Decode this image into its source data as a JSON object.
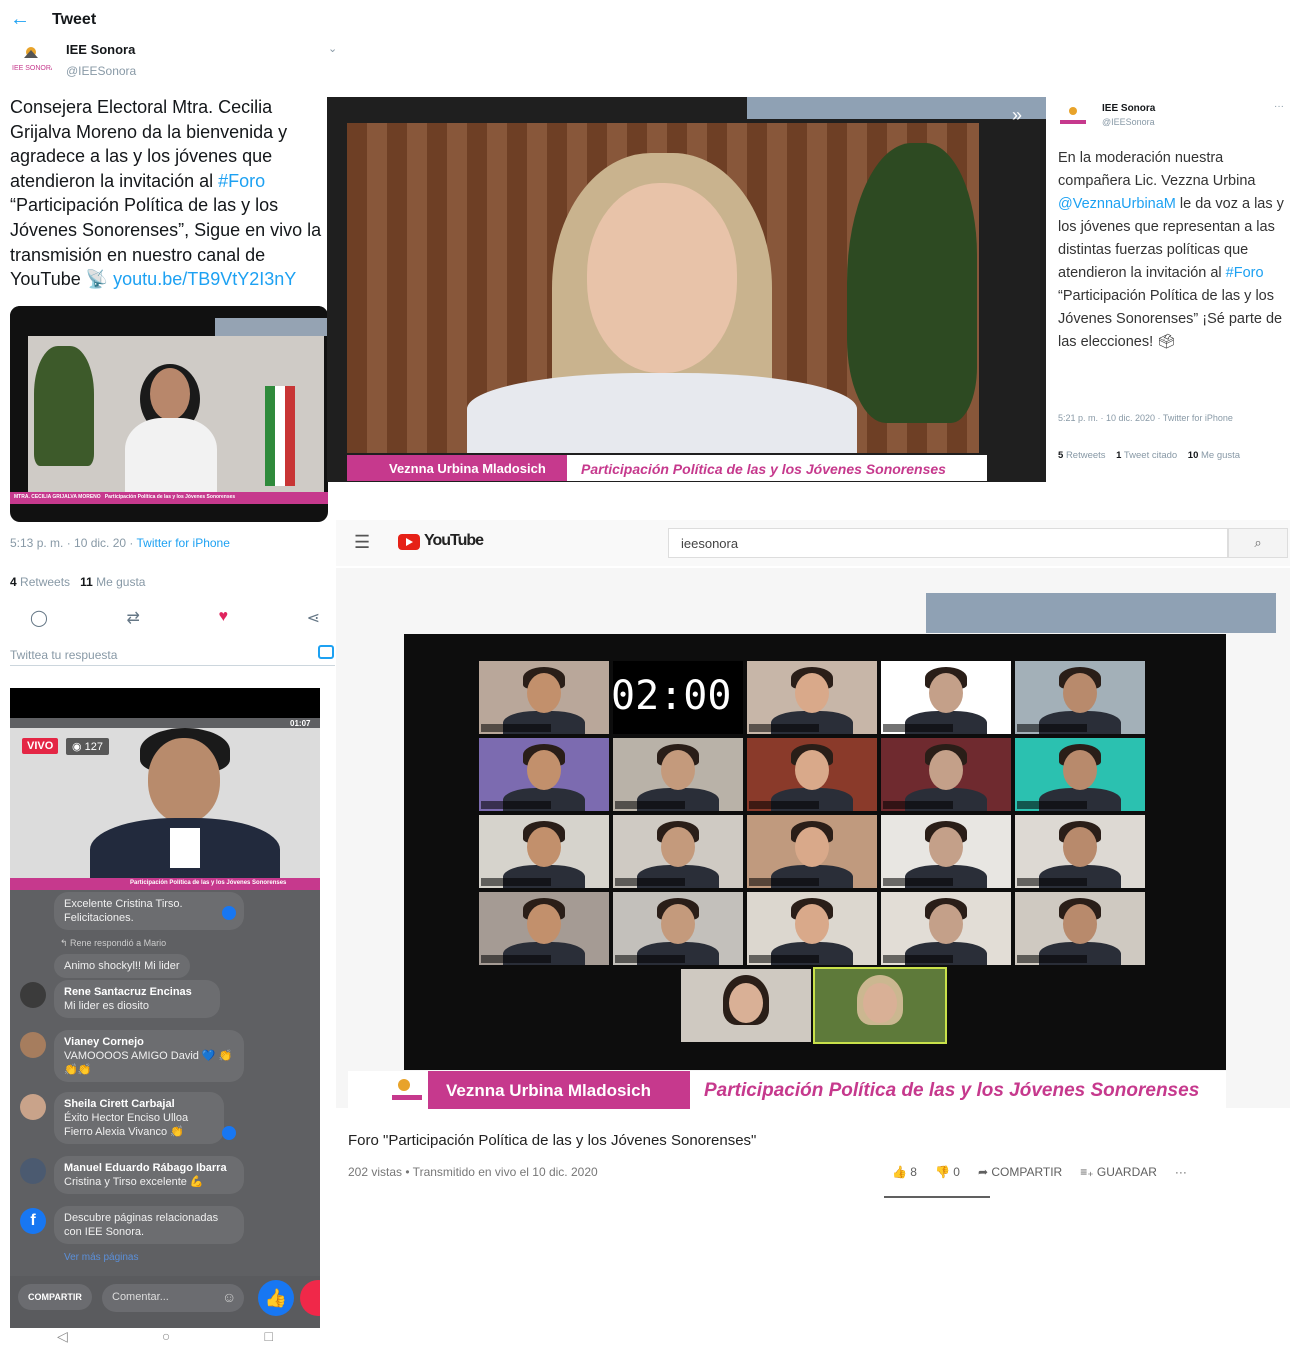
{
  "tweet1": {
    "header_title": "Tweet",
    "account_name": "IEE Sonora",
    "account_handle": "@IEESonora",
    "text": "Consejera Electoral Mtra. Cecilia Grijalva Moreno da la bienvenida y agradece a las y los jóvenes que atendieron la invitación al ",
    "hashtag": "#Foro",
    "text2": " “Participación Política de las y los Jóvenes Sonorenses”, Sigue en vivo la transmisión en nuestro canal de YouTube 📡 ",
    "link": "youtu.be/TB9VtY2I3nY",
    "video_name_tag": "MTRA. CECILIA GRIJALVA MORENO",
    "video_banner": "Participación Política de las y los Jóvenes Sonorenses",
    "time": "5:13 p. m. · 10 dic. 20 · ",
    "source": "Twitter for iPhone",
    "retweets_count": "4",
    "retweets_label": "Retweets",
    "likes_count": "11",
    "likes_label": "Me gusta",
    "reply_placeholder": "Twittea tu respuesta"
  },
  "tweet2": {
    "account_name": "IEE Sonora",
    "account_handle": "@IEESonora",
    "text_a": "En la moderación nuestra compañera Lic. Vezzna Urbina ",
    "mention": "@VeznnaUrbinaM",
    "text_b": " le da voz a las y los jóvenes que representan a las distintas fuerzas políticas que atendieron la invitación al ",
    "hashtag": "#Foro",
    "text_c": " “Participación Política de las y los Jóvenes Sonorenses” ¡Sé parte de las elecciones! 🗳",
    "time": "5:21 p. m. · 10 dic. 2020 · Twitter for iPhone",
    "retweets_count": "5",
    "retweets_label": "Retweets",
    "quotes_count": "1",
    "quotes_label": "Tweet citado",
    "likes_count": "10",
    "likes_label": "Me gusta",
    "video_name_tag": "Veznna Urbina Mladosich",
    "video_banner_a": "Participación Política de las y los ",
    "video_banner_b": "Jóvenes Sonorenses"
  },
  "youtube": {
    "logo_text": "YouTube",
    "search_value": "ieesonora",
    "timer": "02:00",
    "name_tag": "Veznna Urbina Mladosich",
    "banner_a": "Participación Política de las y los ",
    "banner_b": "Jóvenes Sonorenses",
    "video_title": "Foro \"Participación Política de las y los Jóvenes Sonorenses\"",
    "video_meta": "202 vistas • Transmitido en vivo el 10 dic. 2020",
    "likes": "8",
    "dislikes": "0",
    "share_label": "COMPARTIR",
    "save_label": "GUARDAR"
  },
  "facebook": {
    "live_badge": "VIVO",
    "viewers": "127",
    "clock": "01:07",
    "banner": "Participación Política de las y los Jóvenes Sonorenses",
    "comments": [
      {
        "name": "",
        "text": "Excelente Cristina Tirso. Felicitaciones."
      },
      {
        "name": "",
        "text": "Animo shockyl!! Mi lider"
      },
      {
        "name": "Rene Santacruz Encinas",
        "text": "Mi lider es diosito"
      },
      {
        "name": "Vianey Cornejo",
        "text": "VAMOOOOS AMIGO David 💙 👏👏👏"
      },
      {
        "name": "Sheila Cirett Carbajal",
        "text": "Éxito Hector Enciso Ulloa Fierro Alexia Vivanco 👏"
      },
      {
        "name": "Manuel Eduardo Rábago Ibarra",
        "text": "Cristina y Tirso excelente 💪"
      }
    ],
    "reply_note": "Rene respondió a Mario",
    "suggest_text": "Descubre páginas relacionadas con IEE Sonora.",
    "suggest_link": "Ver más páginas",
    "share_button": "COMPARTIR",
    "comment_placeholder": "Comentar..."
  }
}
